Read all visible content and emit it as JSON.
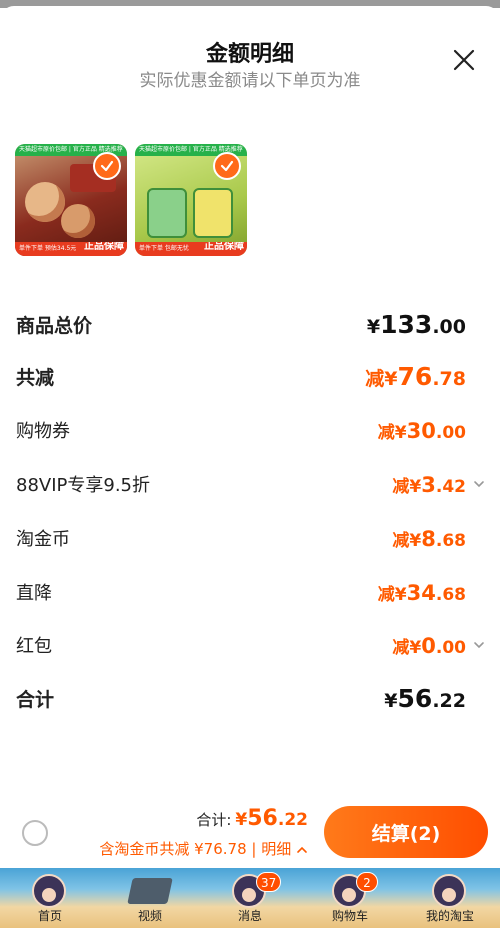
{
  "sheet": {
    "title": "金额明细",
    "subtitle": "实际优惠金额请以下单页为准"
  },
  "products": [
    {
      "top_tag": "天猫超市原价包邮 | 官方正品 精选推荐",
      "bottom_tag": "单件下单 预估34.5元",
      "guarantee": "正品保障",
      "selected": true
    },
    {
      "top_tag": "天猫超市原价包邮 | 官方正品 精选推荐",
      "bottom_tag": "单件下单 包邮无忧",
      "guarantee": "正品保障",
      "selected": true
    }
  ],
  "rows": [
    {
      "label": "商品总价",
      "prefix": "¥",
      "int": "133",
      "dec": ".00"
    },
    {
      "label": "共减",
      "prefix": "减¥",
      "int": "76",
      "dec": ".78"
    },
    {
      "label": "购物券",
      "prefix": "减¥",
      "int": "30",
      "dec": ".00"
    },
    {
      "label": "88VIP专享9.5折",
      "prefix": "减¥",
      "int": "3",
      "dec": ".42"
    },
    {
      "label": "淘金币",
      "prefix": "减¥",
      "int": "8",
      "dec": ".68"
    },
    {
      "label": "直降",
      "prefix": "减¥",
      "int": "34",
      "dec": ".68"
    },
    {
      "label": "红包",
      "prefix": "减¥",
      "int": "0",
      "dec": ".00"
    },
    {
      "label": "合计",
      "prefix": "¥",
      "int": "56",
      "dec": ".22"
    }
  ],
  "footer": {
    "total_label": "合计:",
    "total_prefix": "¥",
    "total_int": "56",
    "total_dec": ".22",
    "detail_text": "含淘金币共减 ¥76.78 | 明细",
    "checkout_label": "结算(2)"
  },
  "tabbar": {
    "tabs": [
      {
        "label": "首页"
      },
      {
        "label": "视频"
      },
      {
        "label": "消息",
        "badge": "37"
      },
      {
        "label": "购物车",
        "badge": "2"
      },
      {
        "label": "我的淘宝"
      }
    ]
  },
  "colors": {
    "accent": "#ff5a00",
    "checkout_start": "#ff7a1a",
    "checkout_end": "#ff4e00"
  },
  "icons": [
    "close-icon",
    "check-icon",
    "chevron-down-icon",
    "chevron-up-icon",
    "radio-icon"
  ]
}
